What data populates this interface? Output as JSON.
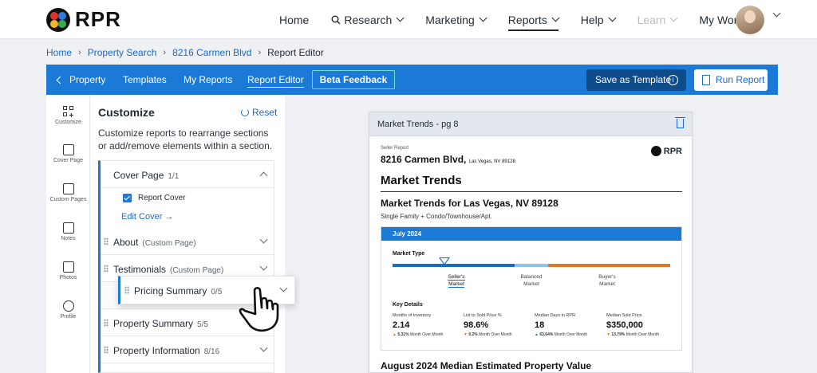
{
  "brand": {
    "name": "RPR"
  },
  "nav": {
    "items": [
      {
        "label": "Home",
        "dropdown": false
      },
      {
        "label": "Research",
        "dropdown": true,
        "icon": "search-icon"
      },
      {
        "label": "Marketing",
        "dropdown": true
      },
      {
        "label": "Reports",
        "dropdown": true,
        "active": true
      },
      {
        "label": "Help",
        "dropdown": true
      },
      {
        "label": "Learn",
        "dropdown": true,
        "disabled": true
      },
      {
        "label": "My Work",
        "dropdown": true
      }
    ]
  },
  "breadcrumb": [
    "Home",
    "Property Search",
    "8216 Carmen Blvd",
    "Report Editor"
  ],
  "toolbar": {
    "back_label": "Property",
    "tabs": [
      "Templates",
      "My Reports",
      "Report Editor"
    ],
    "active_tab": "Report Editor",
    "beta_label": "Beta Feedback",
    "save_template_label": "Save as Template",
    "run_report_label": "Run Report"
  },
  "rail": {
    "items": [
      {
        "label": "Customize",
        "icon": "customize-grid-icon"
      },
      {
        "label": "Cover Page",
        "icon": "cover-page-icon"
      },
      {
        "label": "Custom Pages",
        "icon": "custom-pages-icon"
      },
      {
        "label": "Notes",
        "icon": "notes-icon"
      },
      {
        "label": "Photos",
        "icon": "photos-icon"
      },
      {
        "label": "Profile",
        "icon": "profile-icon"
      }
    ]
  },
  "customize": {
    "title": "Customize",
    "reset_label": "Reset",
    "description": "Customize reports to rearrange sections or add/remove elements within a section.",
    "cover": {
      "name": "Cover Page",
      "count": "1/1",
      "checkbox_label": "Report Cover",
      "edit_label": "Edit Cover →"
    },
    "sections": [
      {
        "name": "About",
        "meta": "(Custom Page)"
      },
      {
        "name": "Testimonials",
        "meta": "(Custom Page)"
      },
      {
        "name": "",
        "meta": ""
      },
      {
        "name": "Property Summary",
        "meta": "5/5"
      },
      {
        "name": "Property Information",
        "meta": "8/16"
      }
    ],
    "dragging": {
      "name": "Pricing Summary",
      "meta": "0/5"
    }
  },
  "preview": {
    "header": "Market Trends - pg 8",
    "report_type": "Seller Report",
    "address": "8216 Carmen Blvd,",
    "address_small": "Las Vegas, NV 89128",
    "logo": "RPR",
    "title": "Market Trends",
    "subtitle": "Market Trends for Las Vegas, NV 89128",
    "property_types": "Single Family + Condo/Townhouse/Apt.",
    "card_month": "July 2024",
    "market_type_label": "Market Type",
    "market_labels": [
      {
        "line1": "Seller's",
        "line2": "Market"
      },
      {
        "line1": "Balanced",
        "line2": "Market"
      },
      {
        "line1": "Buyer's",
        "line2": "Market"
      }
    ],
    "key_details_label": "Key Details",
    "metrics": [
      {
        "label": "Months of Inventory",
        "value": "2.14",
        "change": "5.31%",
        "suffix": "Month Over Month"
      },
      {
        "label": "List to Sold Price %",
        "value": "98.6%",
        "change": "0.2%",
        "suffix": "Month Over Month"
      },
      {
        "label": "Median Days in RPR",
        "value": "18",
        "change": "63.64%",
        "suffix": "Month Over Month"
      },
      {
        "label": "Median Sold Price",
        "value": "$350,000",
        "change": "13.79%",
        "suffix": "Month Over Month"
      }
    ],
    "next_section_title": "August 2024 Median Estimated Property Value"
  },
  "colors": {
    "accent": "#1a7ad6",
    "seller": "#1a6bc4",
    "balanced": "#8cc3ee",
    "buyer": "#e3752a"
  }
}
